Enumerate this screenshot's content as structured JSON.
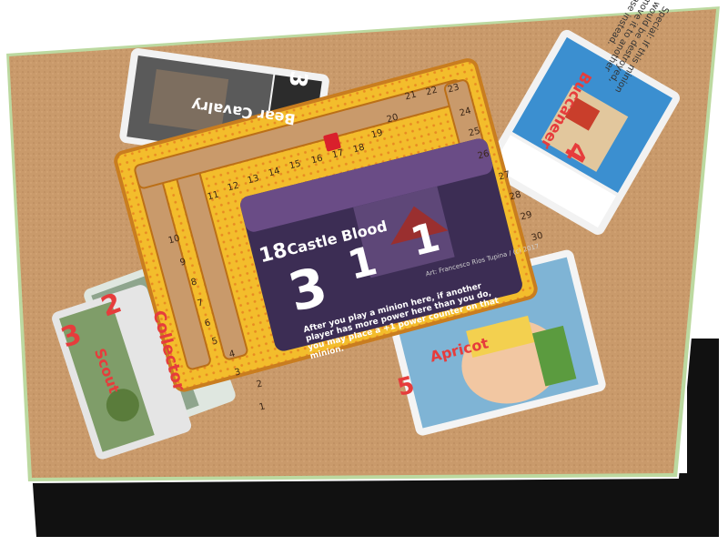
{
  "colors": {
    "frame": "#bcd9a0",
    "felt": "#c99a6b",
    "backing": "#111111",
    "board": "#f3bd2c",
    "board_edge": "#e3462a",
    "base_card": "#3c2d54",
    "accent_red": "#e04040"
  },
  "board": {
    "track_numbers": [
      "1",
      "2",
      "3",
      "4",
      "5",
      "6",
      "7",
      "8",
      "9",
      "10",
      "11",
      "12",
      "13",
      "14",
      "15",
      "16",
      "17",
      "18",
      "19",
      "20",
      "21",
      "22",
      "23",
      "24",
      "25",
      "26",
      "27",
      "28",
      "29",
      "30"
    ]
  },
  "base_card": {
    "breakpoint": "18",
    "name": "Castle Blood",
    "rewards": [
      "3",
      "1",
      "1"
    ],
    "ability": "After you play a minion here, if another player has more power here than you do, you may place a +1 power counter on that minion.",
    "credit": "Art: Francesco Rios Tupina / (c) 2017"
  },
  "cards": {
    "bear_cavalry": {
      "power": "3",
      "name": "Bear Cavalry"
    },
    "buccaneer": {
      "power": "4",
      "name": "Buccaneer",
      "text": "Special: If this minion would be destroyed, move it to another base instead."
    },
    "collector": {
      "power": "2",
      "name": "Collector"
    },
    "scout": {
      "power": "3",
      "name": "Scout"
    },
    "apricot": {
      "power": "5",
      "name": "Apricot"
    }
  }
}
